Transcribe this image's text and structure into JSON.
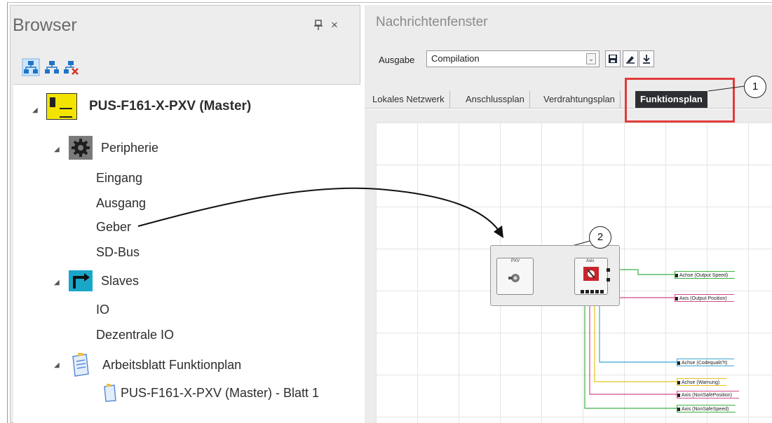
{
  "browser": {
    "title": "Browser",
    "pin_glyph": "❖",
    "close_glyph": "×",
    "tree": {
      "master": "PUS-F161-X-PXV (Master)",
      "peripherie": "Peripherie",
      "eingang": "Eingang",
      "ausgang": "Ausgang",
      "geber": "Geber",
      "sdbus": "SD-Bus",
      "slaves": "Slaves",
      "io": "IO",
      "dezentrale": "Dezentrale IO",
      "arbeitsblatt": "Arbeitsblatt Funktionplan",
      "blatt": "PUS-F161-X-PXV (Master) - Blatt 1"
    }
  },
  "messages": {
    "title": "Nachrichtenfenster",
    "output_label": "Ausgabe",
    "output_value": "Compilation"
  },
  "tabs": [
    "Lokales Netzwerk",
    "Anschlussplan",
    "Verdrahtungsplan",
    "Funktionsplan"
  ],
  "active_tab": "Funktionsplan",
  "callouts": [
    "1",
    "2"
  ],
  "diagram": {
    "pxv_label": "PXV",
    "axis_label": "Axis",
    "outputs": [
      "Achse (Output Speed)",
      "Axis (Output Position)",
      "Achse (Codequalit?t)",
      "Achse (Warnung)",
      "Axis (NonSafePosition)",
      "Axis (NonSafeSpeed)"
    ]
  },
  "colors": {
    "highlight": "#e23b3b",
    "wire_green": "#3cb043",
    "wire_pink": "#d44a8a",
    "wire_blue": "#3aa7d8",
    "wire_yellow": "#e8c31a"
  },
  "icons": [
    "pin-icon",
    "close-icon",
    "network-icon",
    "save-icon",
    "download-icon",
    "gear-icon",
    "slaves-icon",
    "worksheet-icon",
    "axis-icon",
    "encoder-icon"
  ]
}
